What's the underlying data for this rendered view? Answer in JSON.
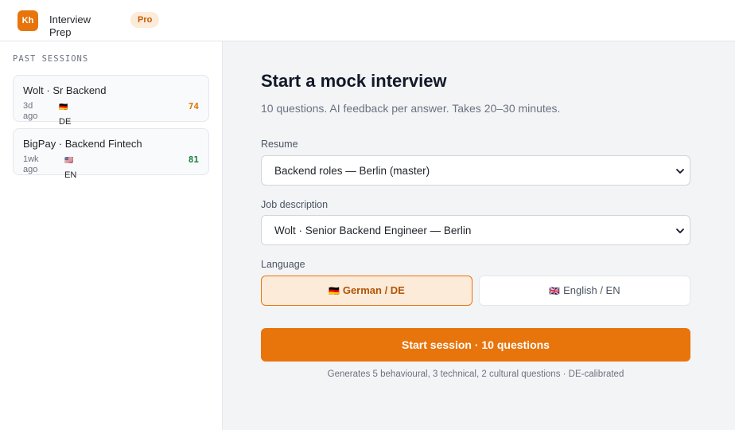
{
  "header": {
    "logo_text": "Kh",
    "app_title": "Interview Prep",
    "badge": "Pro"
  },
  "sidebar": {
    "heading": "PAST SESSIONS",
    "sessions": [
      {
        "title": "Wolt · Sr Backend",
        "age": "3d ago",
        "flag": "🇩🇪",
        "lang": "DE",
        "score": "74",
        "score_color": "#d97706"
      },
      {
        "title": "BigPay · Backend Fintech",
        "age": "1wk ago",
        "flag": "🇺🇸",
        "lang": "EN",
        "score": "81",
        "score_color": "#15803d"
      }
    ]
  },
  "main": {
    "title": "Start a mock interview",
    "subtitle": "10 questions. AI feedback per answer. Takes 20–30 minutes.",
    "resume": {
      "label": "Resume",
      "value": "Backend roles — Berlin (master)"
    },
    "job": {
      "label": "Job description",
      "value": "Wolt · Senior Backend Engineer — Berlin"
    },
    "language": {
      "label": "Language",
      "options": [
        {
          "flag": "🇩🇪",
          "label": "German / DE",
          "selected": true
        },
        {
          "flag": "🇬🇧",
          "label": "English / EN",
          "selected": false
        }
      ]
    },
    "start_button": "Start session · 10 questions",
    "helper": "Generates 5 behavioural, 3 technical, 2 cultural questions · DE-calibrated"
  },
  "colors": {
    "accent": "#e8740c",
    "accent_soft": "#fdebd9"
  }
}
